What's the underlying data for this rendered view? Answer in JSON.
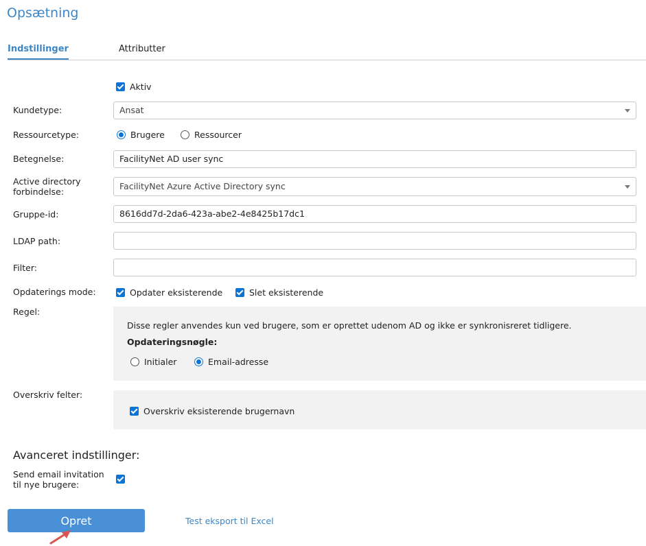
{
  "page": {
    "title": "Opsætning"
  },
  "tabs": [
    {
      "label": "Indstillinger",
      "active": true
    },
    {
      "label": "Attributter",
      "active": false
    }
  ],
  "form": {
    "aktiv": {
      "label": "Aktiv",
      "checked": true
    },
    "kundetype": {
      "label": "Kundetype:",
      "value": "Ansat"
    },
    "ressourcetype": {
      "label": "Ressourcetype:",
      "options": [
        {
          "label": "Brugere",
          "selected": true
        },
        {
          "label": "Ressourcer",
          "selected": false
        }
      ]
    },
    "betegnelse": {
      "label": "Betegnelse:",
      "value": "FacilityNet AD user sync"
    },
    "ad_connection": {
      "label_line1": "Active directory",
      "label_line2": "forbindelse:",
      "value": "FacilityNet Azure Active Directory sync"
    },
    "gruppe_id": {
      "label": "Gruppe-id:",
      "value": "8616dd7d-2da6-423a-abe2-4e8425b17dc1"
    },
    "ldap_path": {
      "label": "LDAP path:",
      "value": ""
    },
    "filter": {
      "label": "Filter:",
      "value": ""
    },
    "opdaterings_mode": {
      "label": "Opdaterings mode:",
      "options": [
        {
          "label": "Opdater eksisterende",
          "checked": true
        },
        {
          "label": "Slet eksisterende",
          "checked": true
        }
      ]
    },
    "regel": {
      "label": "Regel:",
      "description": "Disse regler anvendes kun ved brugere, som er oprettet udenom AD og ikke er synkronisreret tidligere.",
      "key_heading": "Opdateringsnøgle:",
      "options": [
        {
          "label": "Initialer",
          "selected": false
        },
        {
          "label": "Email-adresse",
          "selected": true
        }
      ]
    },
    "overskriv": {
      "label": "Overskriv felter:",
      "option": {
        "label": "Overskriv eksisterende brugernavn",
        "checked": true
      }
    }
  },
  "advanced": {
    "heading": "Avanceret indstillinger:",
    "send_invite": {
      "label_line1": "Send email invitation",
      "label_line2": "til nye brugere:",
      "checked": true
    }
  },
  "actions": {
    "create_label": "Opret",
    "test_export_label": "Test eksport til Excel"
  },
  "colors": {
    "accent": "#3d86c6",
    "button": "#4a90d6",
    "checkbox": "#0b74d6",
    "annotation_arrow": "#d9534f"
  }
}
